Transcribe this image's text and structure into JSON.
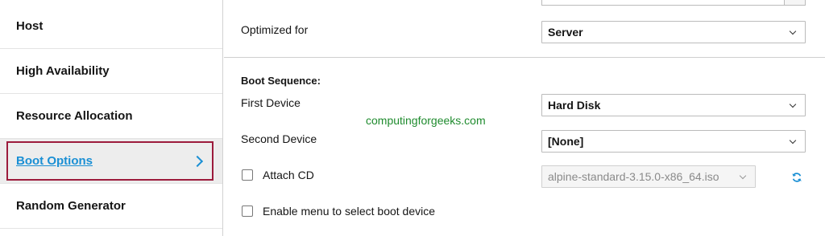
{
  "sidebar": {
    "items": [
      {
        "label": "Host"
      },
      {
        "label": "High Availability"
      },
      {
        "label": "Resource Allocation"
      },
      {
        "label": "Boot Options"
      },
      {
        "label": "Random Generator"
      }
    ]
  },
  "main": {
    "optimized_for": {
      "label": "Optimized for",
      "value": "Server"
    },
    "boot_sequence": {
      "title": "Boot Sequence:",
      "first_device": {
        "label": "First Device",
        "value": "Hard Disk"
      },
      "second_device": {
        "label": "Second Device",
        "value": "[None]"
      }
    },
    "attach_cd": {
      "label": "Attach CD",
      "value": "alpine-standard-3.15.0-x86_64.iso"
    },
    "boot_menu": {
      "label": "Enable menu to select boot device"
    }
  },
  "watermark": "computingforgeeks.com",
  "colors": {
    "accent": "#1a8fd4",
    "active_border": "#9c1b3c",
    "watermark": "#1f8b2e"
  }
}
